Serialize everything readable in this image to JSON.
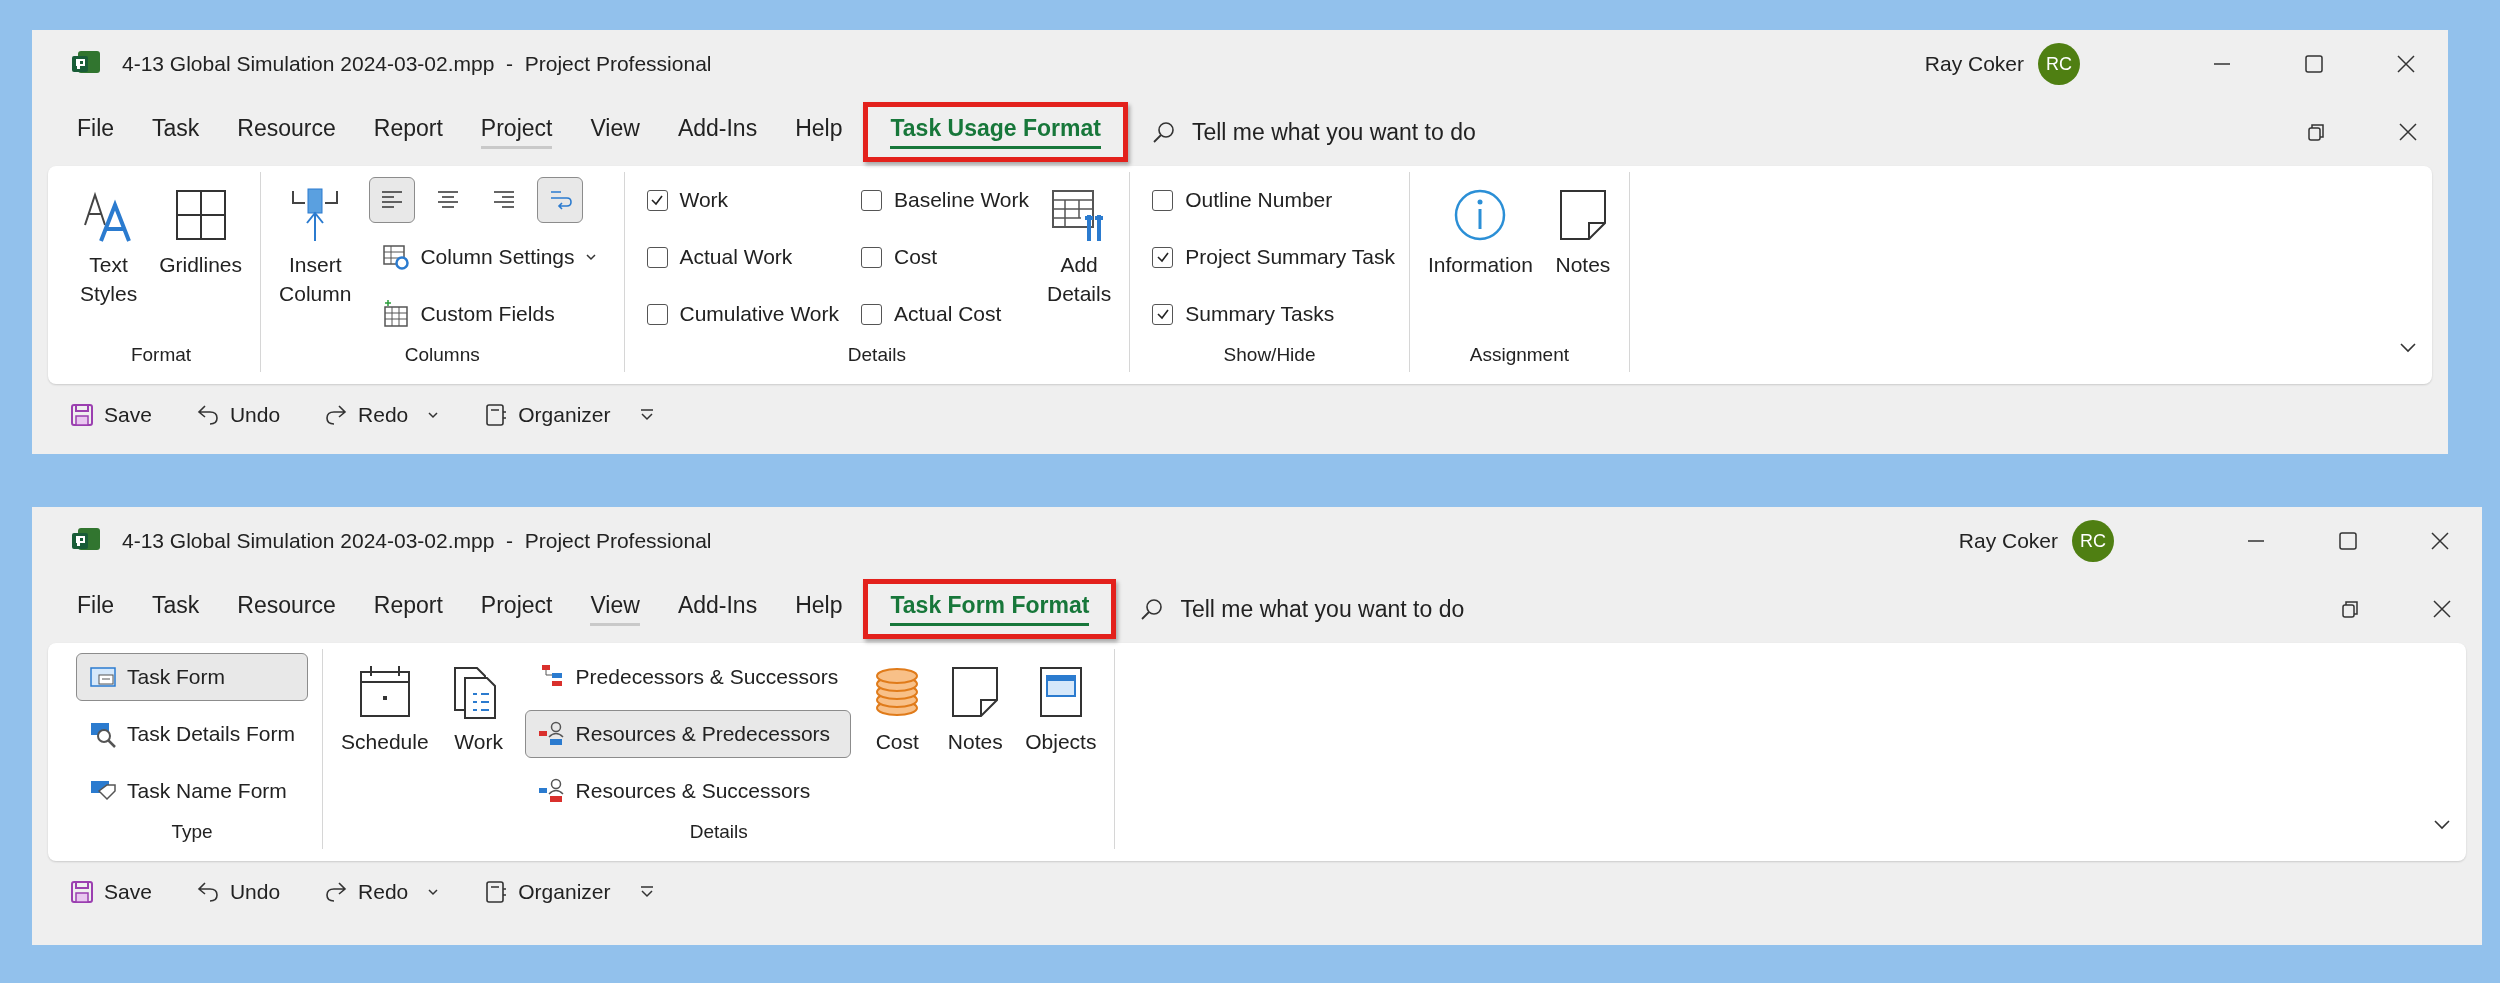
{
  "windows": [
    {
      "title": "4-13 Global Simulation 2024-03-02.mpp  -  Project Professional",
      "user": "Ray Coker",
      "initials": "RC",
      "tabs": [
        {
          "label": "File",
          "selected": false,
          "context": false,
          "highlighted": false
        },
        {
          "label": "Task",
          "selected": false,
          "context": false,
          "highlighted": false
        },
        {
          "label": "Resource",
          "selected": false,
          "context": false,
          "highlighted": false
        },
        {
          "label": "Report",
          "selected": false,
          "context": false,
          "highlighted": false
        },
        {
          "label": "Project",
          "selected": false,
          "context": true,
          "highlighted": false
        },
        {
          "label": "View",
          "selected": false,
          "context": false,
          "highlighted": false
        },
        {
          "label": "Add-Ins",
          "selected": false,
          "context": false,
          "highlighted": false
        },
        {
          "label": "Help",
          "selected": false,
          "context": false,
          "highlighted": false
        },
        {
          "label": "Task Usage Format",
          "selected": true,
          "context": false,
          "highlighted": true
        }
      ],
      "search": {
        "placeholder": "Tell me what you want to do"
      },
      "groups": [
        {
          "label": "Format",
          "columns": [
            {
              "kind": "large",
              "label": "Text Styles"
            },
            {
              "kind": "large",
              "label": "Gridlines"
            }
          ]
        },
        {
          "label": "Columns",
          "columns": [
            {
              "kind": "large",
              "label": "Insert Column"
            },
            {
              "kind": "stack",
              "items": [
                {
                  "kind": "toolbar",
                  "buttons": [
                    {
                      "selected": true
                    },
                    {
                      "selected": false
                    },
                    {
                      "selected": false
                    },
                    {
                      "selected": true
                    }
                  ]
                },
                {
                  "kind": "button",
                  "label": "Column Settings",
                  "selected": false,
                  "dropdown": true
                },
                {
                  "kind": "button",
                  "label": "Custom Fields",
                  "selected": false,
                  "dropdown": false
                }
              ]
            }
          ]
        },
        {
          "label": "Details",
          "columns": [
            {
              "kind": "stack",
              "items": [
                {
                  "kind": "checkbox",
                  "label": "Work",
                  "checked": true
                },
                {
                  "kind": "checkbox",
                  "label": "Actual Work",
                  "checked": false
                },
                {
                  "kind": "checkbox",
                  "label": "Cumulative Work",
                  "checked": false
                }
              ]
            },
            {
              "kind": "stack",
              "items": [
                {
                  "kind": "checkbox",
                  "label": "Baseline Work",
                  "checked": false
                },
                {
                  "kind": "checkbox",
                  "label": "Cost",
                  "checked": false
                },
                {
                  "kind": "checkbox",
                  "label": "Actual Cost",
                  "checked": false
                }
              ]
            },
            {
              "kind": "large",
              "label": "Add Details"
            }
          ]
        },
        {
          "label": "Show/Hide",
          "columns": [
            {
              "kind": "stack",
              "items": [
                {
                  "kind": "checkbox",
                  "label": "Outline Number",
                  "checked": false
                },
                {
                  "kind": "checkbox",
                  "label": "Project Summary Task",
                  "checked": true
                },
                {
                  "kind": "checkbox",
                  "label": "Summary Tasks",
                  "checked": true
                }
              ]
            }
          ]
        },
        {
          "label": "Assignment",
          "columns": [
            {
              "kind": "large",
              "label": "Information"
            },
            {
              "kind": "large",
              "label": "Notes"
            }
          ]
        }
      ],
      "quick_access": [
        {
          "label": "Save",
          "dropdown": false
        },
        {
          "label": "Undo",
          "dropdown": false
        },
        {
          "label": "Redo",
          "dropdown": true
        },
        {
          "label": "Organizer",
          "dropdown": false
        }
      ]
    },
    {
      "title": "4-13 Global Simulation 2024-03-02.mpp  -  Project Professional",
      "user": "Ray Coker",
      "initials": "RC",
      "tabs": [
        {
          "label": "File",
          "selected": false,
          "context": false,
          "highlighted": false
        },
        {
          "label": "Task",
          "selected": false,
          "context": false,
          "highlighted": false
        },
        {
          "label": "Resource",
          "selected": false,
          "context": false,
          "highlighted": false
        },
        {
          "label": "Report",
          "selected": false,
          "context": false,
          "highlighted": false
        },
        {
          "label": "Project",
          "selected": false,
          "context": false,
          "highlighted": false
        },
        {
          "label": "View",
          "selected": false,
          "context": true,
          "highlighted": false
        },
        {
          "label": "Add-Ins",
          "selected": false,
          "context": false,
          "highlighted": false
        },
        {
          "label": "Help",
          "selected": false,
          "context": false,
          "highlighted": false
        },
        {
          "label": "Task Form Format",
          "selected": true,
          "context": false,
          "highlighted": true
        }
      ],
      "search": {
        "placeholder": "Tell me what you want to do"
      },
      "groups": [
        {
          "label": "Type",
          "columns": [
            {
              "kind": "stack",
              "items": [
                {
                  "kind": "button",
                  "label": "Task Form",
                  "selected": true,
                  "dropdown": false
                },
                {
                  "kind": "button",
                  "label": "Task Details Form",
                  "selected": false,
                  "dropdown": false
                },
                {
                  "kind": "button",
                  "label": "Task Name Form",
                  "selected": false,
                  "dropdown": false
                }
              ]
            }
          ]
        },
        {
          "label": "Details",
          "columns": [
            {
              "kind": "large",
              "label": "Schedule"
            },
            {
              "kind": "large",
              "label": "Work"
            },
            {
              "kind": "stack",
              "items": [
                {
                  "kind": "button",
                  "label": "Predecessors & Successors",
                  "selected": false,
                  "dropdown": false
                },
                {
                  "kind": "button",
                  "label": "Resources & Predecessors",
                  "selected": true,
                  "dropdown": false
                },
                {
                  "kind": "button",
                  "label": "Resources & Successors",
                  "selected": false,
                  "dropdown": false
                }
              ]
            },
            {
              "kind": "large",
              "label": "Cost"
            },
            {
              "kind": "large",
              "label": "Notes"
            },
            {
              "kind": "large",
              "label": "Objects"
            }
          ]
        }
      ],
      "quick_access": [
        {
          "label": "Save",
          "dropdown": false
        },
        {
          "label": "Undo",
          "dropdown": false
        },
        {
          "label": "Redo",
          "dropdown": true
        },
        {
          "label": "Organizer",
          "dropdown": false
        }
      ]
    }
  ]
}
